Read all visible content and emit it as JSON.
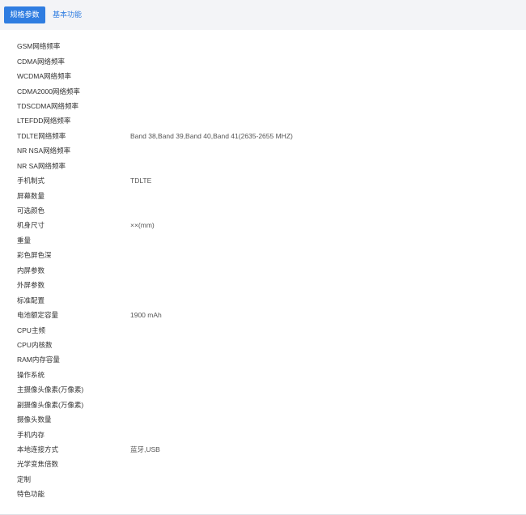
{
  "tabs": [
    {
      "label": "规格参数",
      "active": true
    },
    {
      "label": "基本功能",
      "active": false
    }
  ],
  "specs": [
    {
      "label": "GSM网络频率",
      "value": ""
    },
    {
      "label": "CDMA网络频率",
      "value": ""
    },
    {
      "label": "WCDMA网络频率",
      "value": ""
    },
    {
      "label": "CDMA2000网络频率",
      "value": ""
    },
    {
      "label": "TDSCDMA网络频率",
      "value": ""
    },
    {
      "label": "LTEFDD网络频率",
      "value": ""
    },
    {
      "label": "TDLTE网络频率",
      "value": "Band 38,Band 39,Band 40,Band 41(2635-2655 MHZ)"
    },
    {
      "label": "NR NSA网络频率",
      "value": ""
    },
    {
      "label": "NR SA网络频率",
      "value": ""
    },
    {
      "label": "手机制式",
      "value": "TDLTE"
    },
    {
      "label": "屏幕数量",
      "value": ""
    },
    {
      "label": "可选颜色",
      "value": ""
    },
    {
      "label": "机身尺寸",
      "value": "××(mm)"
    },
    {
      "label": "重量",
      "value": ""
    },
    {
      "label": "彩色屏色深",
      "value": ""
    },
    {
      "label": "内屏参数",
      "value": ""
    },
    {
      "label": "外屏参数",
      "value": ""
    },
    {
      "label": "标准配置",
      "value": ""
    },
    {
      "label": "电池额定容量",
      "value": "1900 mAh"
    },
    {
      "label": "CPU主频",
      "value": ""
    },
    {
      "label": "CPU内核数",
      "value": ""
    },
    {
      "label": "RAM内存容量",
      "value": ""
    },
    {
      "label": "操作系统",
      "value": ""
    },
    {
      "label": "主摄像头像素(万像素)",
      "value": ""
    },
    {
      "label": "副摄像头像素(万像素)",
      "value": ""
    },
    {
      "label": "摄像头数量",
      "value": ""
    },
    {
      "label": "手机内存",
      "value": ""
    },
    {
      "label": "本地连接方式",
      "value": "蓝牙,USB"
    },
    {
      "label": "光学变焦倍数",
      "value": ""
    },
    {
      "label": "定制",
      "value": ""
    },
    {
      "label": "特色功能",
      "value": ""
    }
  ]
}
